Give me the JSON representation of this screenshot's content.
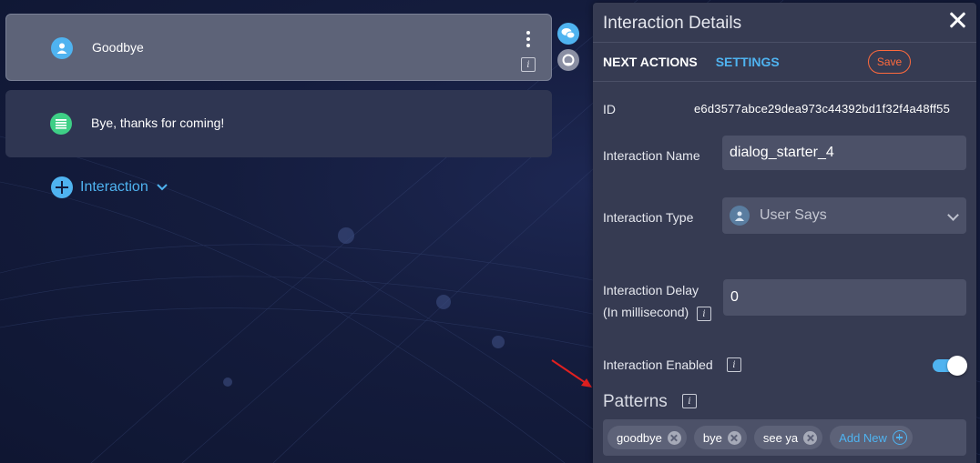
{
  "canvas": {
    "cards": [
      {
        "text": "Goodbye",
        "icon": "user-icon"
      },
      {
        "text": "Bye, thanks for coming!",
        "icon": "text-lines-icon"
      }
    ],
    "add_interaction_label": "Interaction"
  },
  "panel": {
    "title": "Interaction Details",
    "tabs": {
      "next_actions": "NEXT ACTIONS",
      "settings": "SETTINGS"
    },
    "save_label": "Save",
    "id_label": "ID",
    "id_value": "e6d3577abce29dea973c44392bd1f32f4a48ff55",
    "name_label": "Interaction Name",
    "name_value": "dialog_starter_4",
    "type_label": "Interaction Type",
    "type_value": "User Says",
    "delay_label_line1": "Interaction Delay",
    "delay_label_line2": "(In millisecond)",
    "delay_value": "0",
    "enabled_label": "Interaction Enabled",
    "enabled": true,
    "patterns_title": "Patterns",
    "patterns": [
      "goodbye",
      "bye",
      "see ya"
    ],
    "add_new_label": "Add New"
  },
  "colors": {
    "accent": "#4fb3f0",
    "save": "#ff6a3d",
    "panel": "#363b52"
  }
}
